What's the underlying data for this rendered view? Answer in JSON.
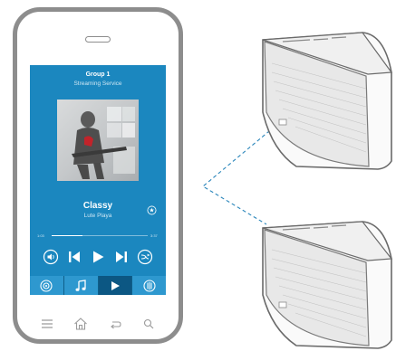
{
  "colors": {
    "screen": "#1b87bf",
    "tab_bg": "#2e98cf",
    "tab_active": "#0c5783",
    "phone_frame": "#8d8d8d",
    "link_line": "#2a86bb"
  },
  "player": {
    "group": "Group 1",
    "service": "Streaming Service",
    "track_title": "Classy",
    "artist": "Lute Playa",
    "elapsed": "1:03",
    "total": "3:37",
    "progress": 0.32
  },
  "controls": [
    "volume-icon",
    "previous-icon",
    "play-icon",
    "next-icon",
    "shuffle-icon"
  ],
  "tabs": [
    {
      "icon": "speaker-icon",
      "active": false
    },
    {
      "icon": "music-note-icon",
      "active": false
    },
    {
      "icon": "play-icon",
      "active": true
    },
    {
      "icon": "radio-icon",
      "active": false
    }
  ],
  "nav": [
    "menu-icon",
    "home-icon",
    "back-icon",
    "search-icon"
  ]
}
